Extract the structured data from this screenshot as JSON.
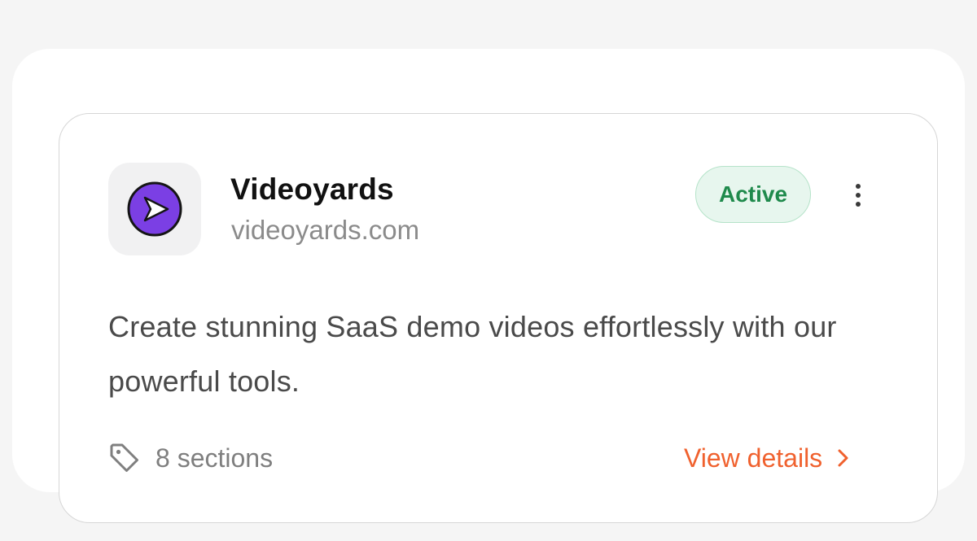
{
  "app": {
    "name": "Videoyards",
    "domain": "videoyards.com",
    "logo_icon": "send-arrow-icon",
    "logo_color": "#7b3fe4"
  },
  "status": {
    "label": "Active",
    "color": "#1f8a4c",
    "background": "#e7f6ee"
  },
  "menu": {
    "icon": "kebab-menu-icon"
  },
  "description": "Create stunning SaaS demo videos effortlessly with our powerful tools.",
  "footer": {
    "tag_icon": "tag-icon",
    "sections_label": "8 sections",
    "view_details_label": "View details",
    "chevron_icon": "chevron-right-icon",
    "accent_color": "#f0612e"
  }
}
